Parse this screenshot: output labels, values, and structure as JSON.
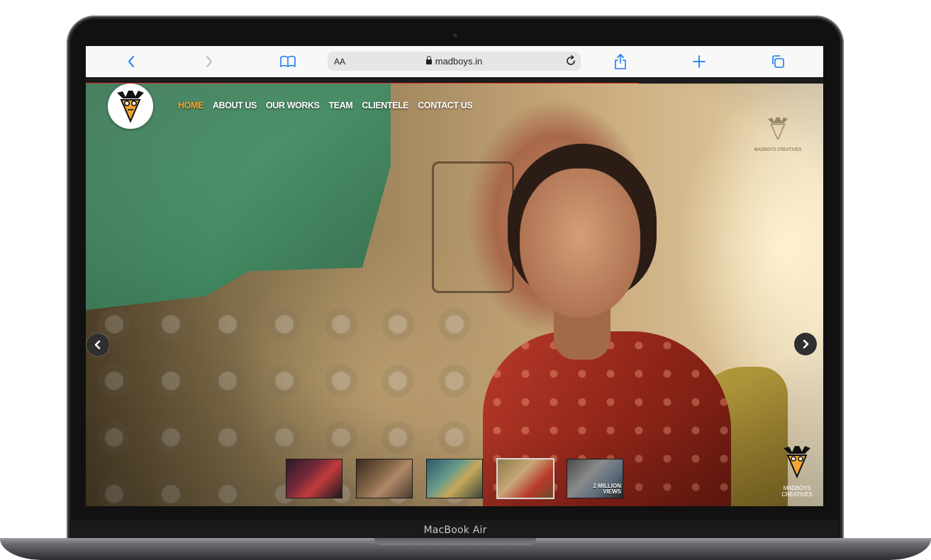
{
  "device": {
    "model_label": "MacBook Air"
  },
  "browser": {
    "text_size_label": "AA",
    "url": "madboys.in",
    "icons": {
      "back": "chevron-left-icon",
      "forward": "chevron-right-icon",
      "bookmarks": "book-icon",
      "reload": "reload-icon",
      "share": "share-icon",
      "new_tab": "plus-icon",
      "tabs": "tabs-icon"
    },
    "accent_color": "#1a7cf5",
    "page_load_progress": 0.75
  },
  "site": {
    "nav": [
      {
        "label": "HOME",
        "active": true
      },
      {
        "label": "ABOUT US",
        "active": false
      },
      {
        "label": "OUR WORKS",
        "active": false
      },
      {
        "label": "TEAM",
        "active": false
      },
      {
        "label": "CLIENTELE",
        "active": false
      },
      {
        "label": "CONTACT US",
        "active": false
      }
    ],
    "nav_active_color": "#f3a531",
    "watermark_text": "MADBOYS CREATIVES",
    "slider": {
      "prev_icon": "chevron-left-icon",
      "next_icon": "chevron-right-icon",
      "active_index": 3,
      "thumbnails": [
        {
          "caption": ""
        },
        {
          "caption": ""
        },
        {
          "caption": ""
        },
        {
          "caption": ""
        },
        {
          "caption_line1": "2 MILLION",
          "caption_line2": "VIEWS"
        }
      ]
    }
  }
}
